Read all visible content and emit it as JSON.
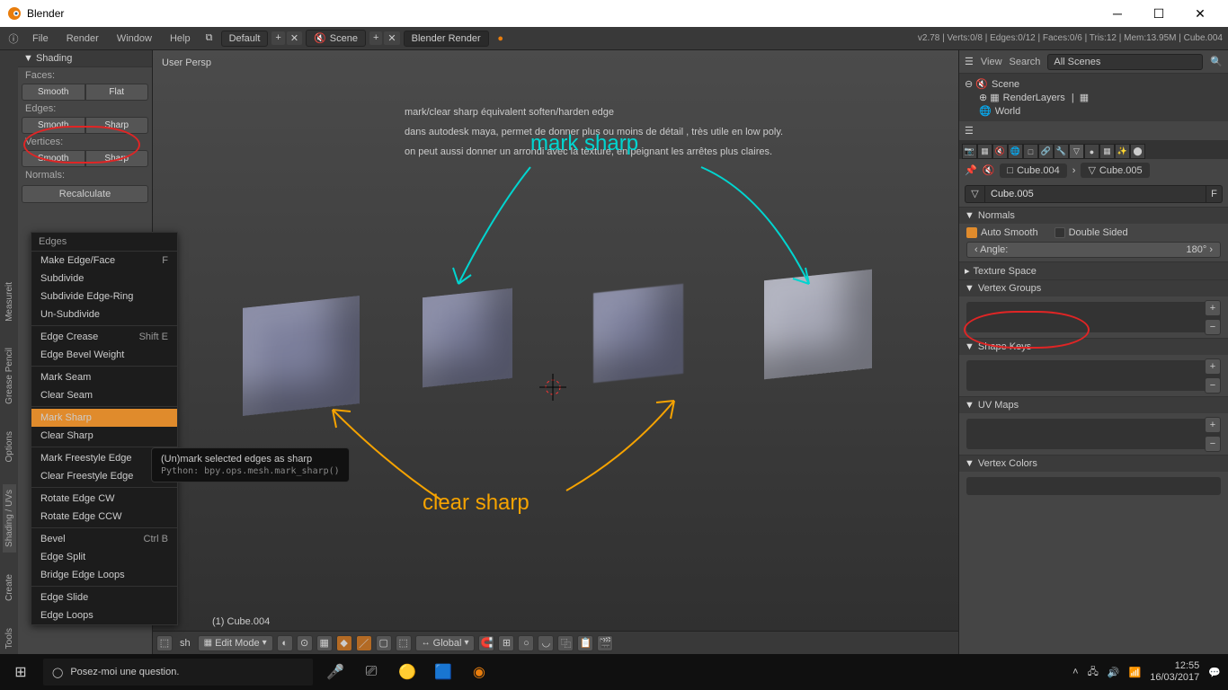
{
  "window": {
    "title": "Blender"
  },
  "menubar": {
    "items": [
      "File",
      "Render",
      "Window",
      "Help"
    ],
    "layout": "Default",
    "scene": "Scene",
    "engine": "Blender Render",
    "stats": "v2.78 | Verts:0/8 | Edges:0/12 | Faces:0/6 | Tris:12 | Mem:13.95M | Cube.004"
  },
  "vtabs": [
    "Tools",
    "Create",
    "Shading / UVs",
    "Options",
    "Grease Pencil",
    "Measureit"
  ],
  "toolshelf": {
    "panel": "Shading",
    "faces_lbl": "Faces:",
    "faces_btns": [
      "Smooth",
      "Flat"
    ],
    "edges_lbl": "Edges:",
    "edges_btns": [
      "Smooth",
      "Sharp"
    ],
    "verts_lbl": "Vertices:",
    "verts_btns": [
      "Smooth",
      "Sharp"
    ],
    "normals_lbl": "Normals:",
    "recalc": "Recalculate"
  },
  "ctxmenu": {
    "header": "Edges",
    "items": [
      {
        "label": "Make Edge/Face",
        "sc": "F"
      },
      {
        "label": "Subdivide"
      },
      {
        "label": "Subdivide Edge-Ring"
      },
      {
        "label": "Un-Subdivide"
      },
      {
        "sep": true
      },
      {
        "label": "Edge Crease",
        "sc": "Shift E"
      },
      {
        "label": "Edge Bevel Weight"
      },
      {
        "sep": true
      },
      {
        "label": "Mark Seam"
      },
      {
        "label": "Clear Seam"
      },
      {
        "sep": true
      },
      {
        "label": "Mark Sharp",
        "hl": true
      },
      {
        "label": "Clear Sharp"
      },
      {
        "sep": true
      },
      {
        "label": "Mark Freestyle Edge"
      },
      {
        "label": "Clear Freestyle Edge"
      },
      {
        "sep": true
      },
      {
        "label": "Rotate Edge CW"
      },
      {
        "label": "Rotate Edge CCW"
      },
      {
        "sep": true
      },
      {
        "label": "Bevel",
        "sc": "Ctrl B"
      },
      {
        "label": "Edge Split"
      },
      {
        "label": "Bridge Edge Loops"
      },
      {
        "sep": true
      },
      {
        "label": "Edge Slide"
      },
      {
        "label": "Edge Loops"
      }
    ]
  },
  "tooltip": {
    "text": "(Un)mark selected edges as sharp",
    "python": "Python: bpy.ops.mesh.mark_sharp()"
  },
  "viewport": {
    "persp": "User Persp",
    "objname": "(1) Cube.004",
    "note_lines": [
      "mark/clear sharp équivalent soften/harden edge",
      "dans autodesk maya, permet de donner plus ou moins de détail , très utile en low poly.",
      "on peut aussi donner un arrondi avec la texture, en peignant les arrêtes plus claires."
    ],
    "annot_mark": "mark sharp",
    "annot_clear": "clear sharp"
  },
  "vpheader": {
    "mode": "Edit Mode",
    "orient": "Global"
  },
  "outliner": {
    "items": [
      "View",
      "Search"
    ],
    "filter": "All Scenes",
    "tree": {
      "scene": "Scene",
      "layers": "RenderLayers",
      "world": "World"
    }
  },
  "props": {
    "crumb1": "Cube.004",
    "crumb2": "Cube.005",
    "name": "Cube.005",
    "normals_hdr": "Normals",
    "auto_smooth": "Auto Smooth",
    "double_sided": "Double Sided",
    "angle_lbl": "Angle:",
    "angle_val": "180°",
    "panels": [
      "Texture Space",
      "Vertex Groups",
      "Shape Keys",
      "UV Maps",
      "Vertex Colors"
    ]
  },
  "taskbar": {
    "search_placeholder": "Posez-moi une question.",
    "time": "12:55",
    "date": "16/03/2017"
  }
}
